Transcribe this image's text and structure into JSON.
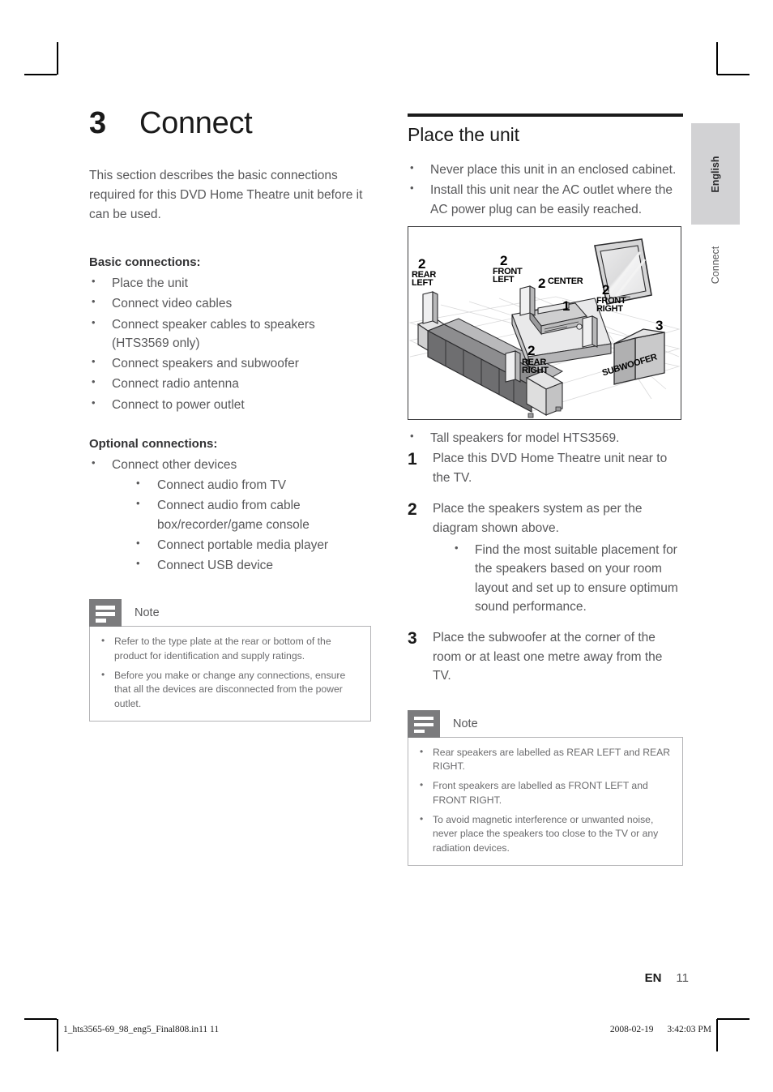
{
  "chapter": {
    "number": "3",
    "title": "Connect"
  },
  "intro": "This section describes the basic connections required for this DVD Home Theatre unit before it can be used.",
  "basic": {
    "heading": "Basic connections:",
    "items": [
      "Place the unit",
      "Connect video cables",
      "Connect speaker cables to speakers (HTS3569 only)",
      "Connect speakers and subwoofer",
      "Connect radio antenna",
      "Connect to power outlet"
    ]
  },
  "optional": {
    "heading": "Optional connections:",
    "items": [
      "Connect other devices"
    ],
    "subitems": [
      "Connect audio from TV",
      "Connect audio from cable box/recorder/game console",
      "Connect portable media player",
      "Connect USB device"
    ]
  },
  "note_left": {
    "label": "Note",
    "icon": "note-lines-icon",
    "items": [
      "Refer to the type plate at the rear or bottom of the product for identification and supply ratings.",
      "Before you make or change any connections, ensure that all the devices are disconnected from the power outlet."
    ]
  },
  "section": {
    "title": "Place the unit",
    "bullets": [
      "Never place this unit in an enclosed cabinet.",
      "Install this unit near the AC outlet where the AC power plug can be easily reached."
    ],
    "figure_note": "Tall speakers for model HTS3569.",
    "steps": [
      {
        "number": "1",
        "text": "Place this DVD Home Theatre unit near to the TV.",
        "subitems": []
      },
      {
        "number": "2",
        "text": "Place the speakers system as per the diagram shown above.",
        "subitems": [
          "Find the most suitable placement for the speakers based on your room layout and set up to ensure optimum sound performance."
        ]
      },
      {
        "number": "3",
        "text": "Place the subwoofer at the corner of the room or at least one metre away from the TV.",
        "subitems": []
      }
    ]
  },
  "note_right": {
    "label": "Note",
    "icon": "note-lines-icon",
    "items": [
      "Rear speakers are labelled as REAR LEFT and REAR RIGHT.",
      "Front speakers are labelled as FRONT LEFT and FRONT RIGHT.",
      "To avoid magnetic interference or unwanted noise, never place the speakers too close to the TV or any radiation devices."
    ]
  },
  "diagram": {
    "labels": [
      {
        "number": "2",
        "name": "REAR\nLEFT"
      },
      {
        "number": "2",
        "name": "FRONT\nLEFT"
      },
      {
        "number": "2",
        "name": "CENTER"
      },
      {
        "number": "1",
        "name": ""
      },
      {
        "number": "2",
        "name": "FRONT\nRIGHT"
      },
      {
        "number": "2",
        "name": "REAR\nRIGHT"
      },
      {
        "number": "3",
        "name": "SUBWOOFER"
      }
    ]
  },
  "side": {
    "language": "English",
    "chapter": "Connect"
  },
  "footer": {
    "lang_code": "EN",
    "page": "11",
    "filename": "1_hts3565-69_98_eng5_Final808.in11   11",
    "date": "2008-02-19",
    "time": "3:42:03 PM"
  }
}
